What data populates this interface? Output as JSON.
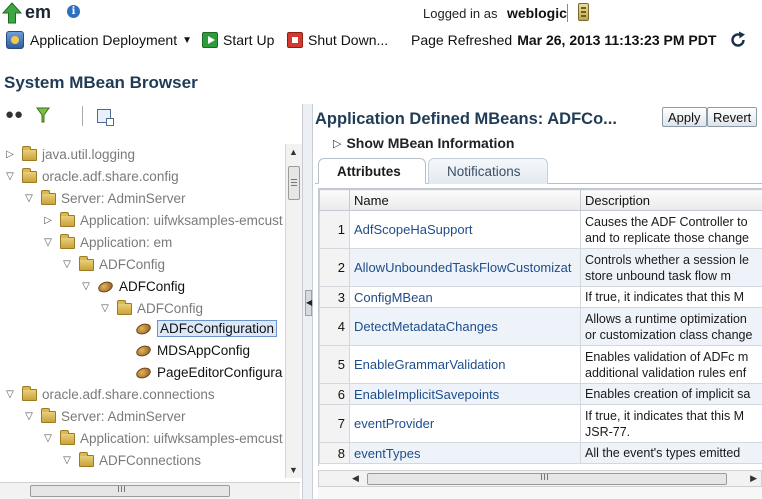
{
  "app": {
    "name": "em",
    "logged_in_label": "Logged in as",
    "user": "weblogic"
  },
  "toolbar": {
    "deployment_menu": "Application Deployment",
    "start_up": "Start Up",
    "shut_down": "Shut Down...",
    "refreshed_label": "Page Refreshed",
    "refreshed_time": "Mar 26, 2013 11:13:23 PM PDT"
  },
  "page_title": "System MBean Browser",
  "tree": {
    "nodes": [
      {
        "label": "java.util.logging",
        "toggle": "collapsed",
        "icon": "folder-icon",
        "style": "muted"
      },
      {
        "label": "oracle.adf.share.config",
        "toggle": "expanded",
        "icon": "folder-icon",
        "style": "muted"
      },
      {
        "label": "Server: AdminServer",
        "toggle": "expanded",
        "icon": "folder-icon",
        "style": "muted"
      },
      {
        "label": "Application: uifwksamples-emcust",
        "toggle": "collapsed",
        "icon": "folder-icon",
        "style": "muted"
      },
      {
        "label": "Application: em",
        "toggle": "expanded",
        "icon": "folder-icon",
        "style": "muted"
      },
      {
        "label": "ADFConfig",
        "toggle": "expanded",
        "icon": "folder-icon",
        "style": "muted"
      },
      {
        "label": "ADFConfig",
        "toggle": "expanded",
        "icon": "bean-icon",
        "style": "dark"
      },
      {
        "label": "ADFConfig",
        "toggle": "expanded",
        "icon": "folder-icon",
        "style": "muted"
      },
      {
        "label": "ADFcConfiguration",
        "toggle": "none",
        "icon": "bean-icon",
        "style": "selected"
      },
      {
        "label": "MDSAppConfig",
        "toggle": "none",
        "icon": "bean-icon",
        "style": "dark"
      },
      {
        "label": "PageEditorConfigura",
        "toggle": "none",
        "icon": "bean-icon",
        "style": "dark"
      },
      {
        "label": "oracle.adf.share.connections",
        "toggle": "expanded",
        "icon": "folder-icon",
        "style": "muted"
      },
      {
        "label": "Server: AdminServer",
        "toggle": "expanded",
        "icon": "folder-icon",
        "style": "muted"
      },
      {
        "label": "Application: uifwksamples-emcust",
        "toggle": "expanded",
        "icon": "folder-icon",
        "style": "muted"
      },
      {
        "label": "ADFConnections",
        "toggle": "expanded",
        "icon": "folder-icon",
        "style": "muted"
      }
    ]
  },
  "detail": {
    "title": "Application Defined MBeans: ADFCo...",
    "apply": "Apply",
    "revert": "Revert",
    "show_info": "Show MBean Information",
    "tabs": [
      "Attributes",
      "Notifications"
    ],
    "columns": [
      "Name",
      "Description"
    ],
    "rows": [
      {
        "num": "1",
        "name": "AdfScopeHaSupport",
        "desc": [
          "Causes the ADF Controller to",
          "and to replicate those change"
        ]
      },
      {
        "num": "2",
        "name": "AllowUnboundedTaskFlowCustomizat",
        "desc": [
          "Controls whether a session le",
          "store unbound task flow m"
        ]
      },
      {
        "num": "3",
        "name": "ConfigMBean",
        "desc": [
          "If true, it indicates that this M"
        ]
      },
      {
        "num": "4",
        "name": "DetectMetadataChanges",
        "desc": [
          "Allows a runtime optimization",
          "or customization class change"
        ]
      },
      {
        "num": "5",
        "name": "EnableGrammarValidation",
        "desc": [
          "Enables validation of ADFc m",
          "additional validation rules enf"
        ]
      },
      {
        "num": "6",
        "name": "EnableImplicitSavepoints",
        "desc": [
          "Enables creation of implicit sa"
        ]
      },
      {
        "num": "7",
        "name": "eventProvider",
        "desc": [
          "If true, it indicates that this M",
          "JSR-77."
        ]
      },
      {
        "num": "8",
        "name": "eventTypes",
        "desc": [
          "All the event's types emitted"
        ]
      }
    ]
  },
  "colors": {
    "title_text": "#1f3b55",
    "link_text": "#1f4d8a",
    "selected_bg": "#dce8f7"
  }
}
